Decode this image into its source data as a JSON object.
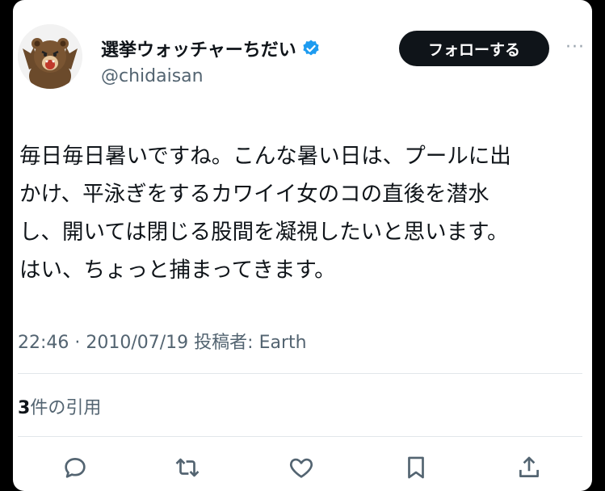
{
  "user": {
    "display_name": "選挙ウォッチャーちだい",
    "handle": "@chidaisan",
    "verified": true,
    "avatar_icon": "bear-icon"
  },
  "follow_button": {
    "label": "フォローする"
  },
  "more_button": {
    "label": "···"
  },
  "tweet": {
    "lines": [
      "毎日毎日暑いですね。こんな暑い日は、プールに出",
      "かけ、平泳ぎをするカワイイ女のコの直後を潜水",
      "し、開いては閉じる股間を凝視したいと思います。",
      "はい、ちょっと捕まってきます。"
    ]
  },
  "meta": {
    "text": "22:46 · 2010/07/19 投稿者: Earth"
  },
  "quotes": {
    "count": "3",
    "label": "件の引用"
  },
  "actions": [
    {
      "icon": "reply-icon"
    },
    {
      "icon": "retweet-icon"
    },
    {
      "icon": "like-icon"
    },
    {
      "icon": "bookmark-icon"
    },
    {
      "icon": "share-icon"
    }
  ],
  "colors": {
    "text": "#0f1419",
    "secondary": "#536471",
    "verified": "#1d9bf0",
    "follow_bg": "#0f1419"
  }
}
